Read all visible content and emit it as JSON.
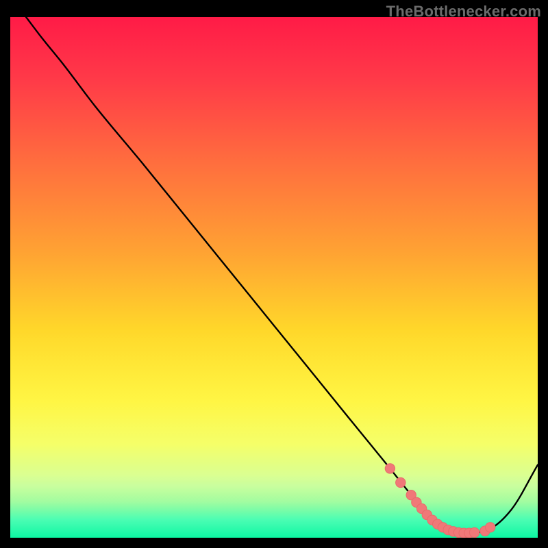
{
  "attribution": "TheBottlenecker.com",
  "colors": {
    "black": "#000000",
    "line": "#000000",
    "marker_fill": "#f07878",
    "marker_stroke": "#e86b6b",
    "gradient_stops": [
      {
        "offset": 0.0,
        "color": "#ff1b47"
      },
      {
        "offset": 0.12,
        "color": "#ff3a48"
      },
      {
        "offset": 0.28,
        "color": "#ff6e3e"
      },
      {
        "offset": 0.45,
        "color": "#ffa233"
      },
      {
        "offset": 0.6,
        "color": "#ffd72a"
      },
      {
        "offset": 0.74,
        "color": "#fff423"
      },
      {
        "offset": 0.82,
        "color": "#f2ff3a"
      },
      {
        "offset": 0.88,
        "color": "#ccff66"
      },
      {
        "offset": 0.93,
        "color": "#8dfc8a"
      },
      {
        "offset": 0.965,
        "color": "#3dfdad"
      },
      {
        "offset": 1.0,
        "color": "#0cf7a3"
      }
    ],
    "pale_band_alpha": 0.35
  },
  "chart_data": {
    "type": "line",
    "title": "",
    "xlabel": "",
    "ylabel": "",
    "xlim": [
      0,
      100
    ],
    "ylim": [
      0,
      100
    ],
    "grid": false,
    "legend": null,
    "series": [
      {
        "name": "bottleneck-curve",
        "x": [
          3,
          6,
          10,
          16,
          25,
          35,
          45,
          55,
          65,
          72,
          76,
          78,
          80,
          82,
          84,
          86,
          90,
          95,
          100
        ],
        "y": [
          100,
          96,
          91,
          83,
          72,
          59.5,
          47,
          34.5,
          22,
          13.3,
          8.2,
          5.6,
          3.4,
          2.0,
          1.2,
          0.9,
          1.3,
          5.4,
          14.0
        ]
      }
    ],
    "markers": {
      "name": "fit-region",
      "x": [
        72,
        74,
        76,
        77,
        78,
        79,
        80,
        81,
        82,
        83,
        84,
        85,
        86,
        87,
        88,
        90,
        91
      ],
      "y": [
        13.3,
        10.6,
        8.2,
        6.8,
        5.6,
        4.4,
        3.4,
        2.6,
        2.0,
        1.5,
        1.2,
        1.0,
        0.9,
        0.9,
        1.0,
        1.3,
        2.0
      ]
    }
  }
}
